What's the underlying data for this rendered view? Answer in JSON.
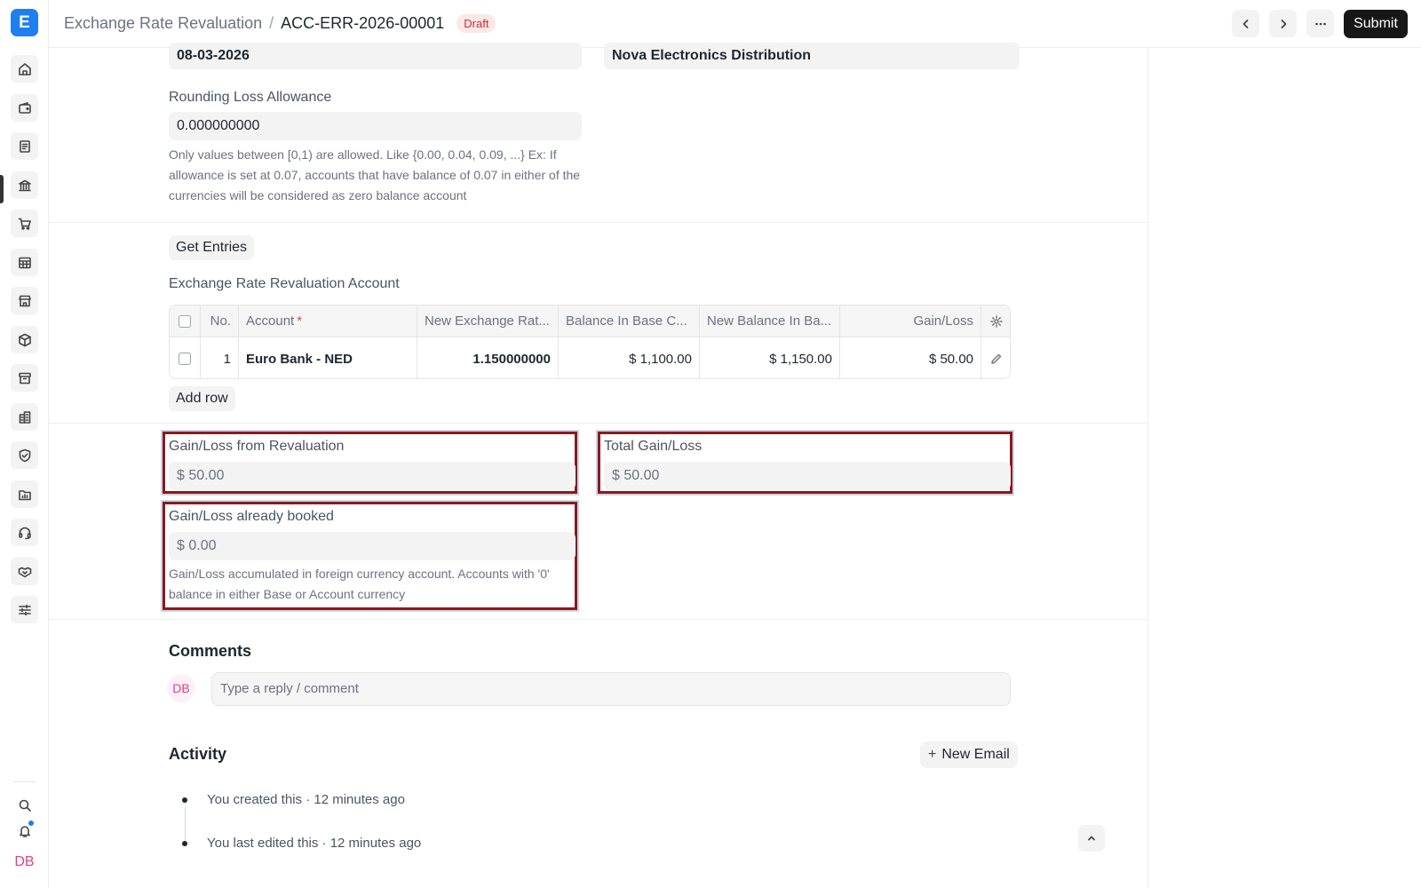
{
  "app": {
    "logo_letter": "E"
  },
  "header": {
    "parent": "Exchange Rate Revaluation",
    "separator": "/",
    "doc_name": "ACC-ERR-2026-00001",
    "status": "Draft",
    "submit_label": "Submit"
  },
  "form": {
    "posting_date": "08-03-2026",
    "company": "Nova Electronics Distribution",
    "rounding_label": "Rounding Loss Allowance",
    "rounding_value": "0.000000000",
    "rounding_desc": "Only values between [0,1) are allowed. Like {0.00, 0.04, 0.09, ...} Ex: If allowance is set at 0.07, accounts that have balance of 0.07 in either of the currencies will be considered as zero balance account",
    "get_entries_label": "Get Entries",
    "table_label": "Exchange Rate Revaluation Account",
    "columns": {
      "no": "No.",
      "account": "Account",
      "required_mark": "*",
      "new_rate": "New Exchange Rat...",
      "balance_base": "Balance In Base C...",
      "new_balance_base": "New Balance In Ba...",
      "gain_loss": "Gain/Loss"
    },
    "rows": [
      {
        "no": "1",
        "account": "Euro Bank - NED",
        "new_rate": "1.150000000",
        "balance_base": "$ 1,100.00",
        "new_balance_base": "$ 1,150.00",
        "gain_loss": "$ 50.00"
      }
    ],
    "add_row_label": "Add row",
    "gain_loss_reval_label": "Gain/Loss from Revaluation",
    "gain_loss_reval_value": "$ 50.00",
    "total_gain_loss_label": "Total Gain/Loss",
    "total_gain_loss_value": "$ 50.00",
    "gain_loss_booked_label": "Gain/Loss already booked",
    "gain_loss_booked_value": "$ 0.00",
    "gain_loss_booked_desc": "Gain/Loss accumulated in foreign currency account. Accounts with '0' balance in either Base or Account currency"
  },
  "comments": {
    "heading": "Comments",
    "avatar_initials": "DB",
    "placeholder": "Type a reply / comment"
  },
  "activity": {
    "heading": "Activity",
    "new_email_label": "New Email",
    "plus": "+",
    "items": [
      "You created this · 12 minutes ago",
      "You last edited this · 12 minutes ago"
    ]
  },
  "user": {
    "initials": "DB"
  },
  "colors": {
    "accent": "#1f7ef0",
    "highlight_border": "#8b1a1a",
    "draft_badge": "#c53030"
  }
}
